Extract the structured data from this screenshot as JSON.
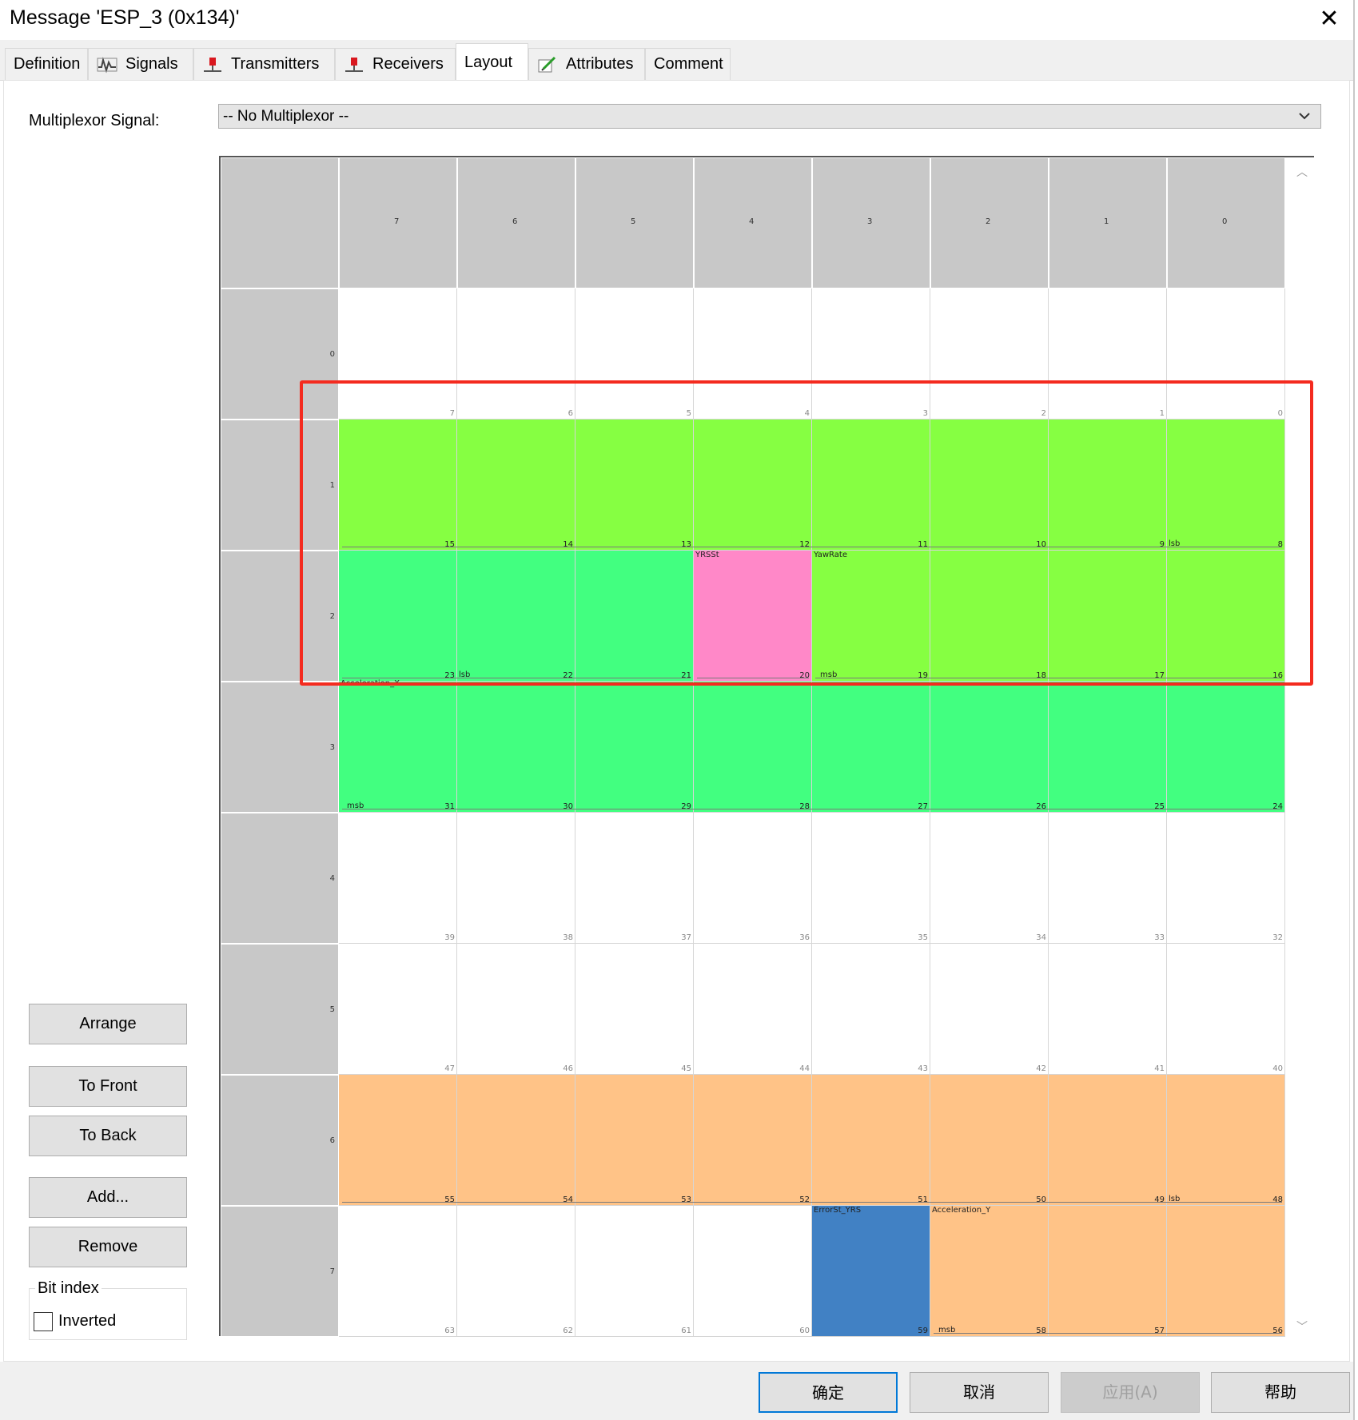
{
  "window": {
    "title": "Message 'ESP_3 (0x134)'"
  },
  "tabs": [
    {
      "label": "Definition",
      "icon": "none"
    },
    {
      "label": "Signals",
      "icon": "signal-wave-icon"
    },
    {
      "label": "Transmitters",
      "icon": "network-node-icon"
    },
    {
      "label": "Receivers",
      "icon": "network-node-icon"
    },
    {
      "label": "Layout",
      "icon": "none",
      "active": true
    },
    {
      "label": "Attributes",
      "icon": "attributes-pencil-icon"
    },
    {
      "label": "Comment",
      "icon": "none"
    }
  ],
  "multiplexor": {
    "label": "Multiplexor Signal:",
    "value": "-- No Multiplexor --"
  },
  "layout_grid": {
    "bit_headers": [
      "7",
      "6",
      "5",
      "4",
      "3",
      "2",
      "1",
      "0"
    ],
    "byte_headers": [
      "0",
      "1",
      "2",
      "3",
      "4",
      "5",
      "6",
      "7"
    ],
    "bit_numbers": [
      [
        "7",
        "6",
        "5",
        "4",
        "3",
        "2",
        "1",
        "0"
      ],
      [
        "15",
        "14",
        "13",
        "12",
        "11",
        "10",
        "9",
        "8"
      ],
      [
        "23",
        "22",
        "21",
        "20",
        "19",
        "18",
        "17",
        "16"
      ],
      [
        "31",
        "30",
        "29",
        "28",
        "27",
        "26",
        "25",
        "24"
      ],
      [
        "39",
        "38",
        "37",
        "36",
        "35",
        "34",
        "33",
        "32"
      ],
      [
        "47",
        "46",
        "45",
        "44",
        "43",
        "42",
        "41",
        "40"
      ],
      [
        "55",
        "54",
        "53",
        "52",
        "51",
        "50",
        "49",
        "48"
      ],
      [
        "63",
        "62",
        "61",
        "60",
        "59",
        "58",
        "57",
        "56"
      ]
    ],
    "signals": [
      {
        "name": "YawRate",
        "color": "#86ff42",
        "msb_label": "msb",
        "lsb_label": "lsb"
      },
      {
        "name": "YRSSt",
        "color": "#ff88c8"
      },
      {
        "name": "Acceleration_X",
        "color": "#42ff80",
        "msb_label": "msb",
        "lsb_label": "lsb"
      },
      {
        "name": "Acceleration_Y",
        "color": "#ffc387",
        "msb_label": "msb",
        "lsb_label": "lsb"
      },
      {
        "name": "ErrorSt_YRS",
        "color": "#4181c4"
      }
    ],
    "highlight_color": "#f42b1f"
  },
  "side_buttons": {
    "arrange": "Arrange",
    "to_front": "To Front",
    "to_back": "To Back",
    "add": "Add...",
    "remove": "Remove"
  },
  "bit_index": {
    "label": "Bit index",
    "inverted_label": "Inverted",
    "inverted_checked": false
  },
  "footer_buttons": {
    "ok": "确定",
    "cancel": "取消",
    "apply": "应用(A)",
    "help": "帮助"
  }
}
